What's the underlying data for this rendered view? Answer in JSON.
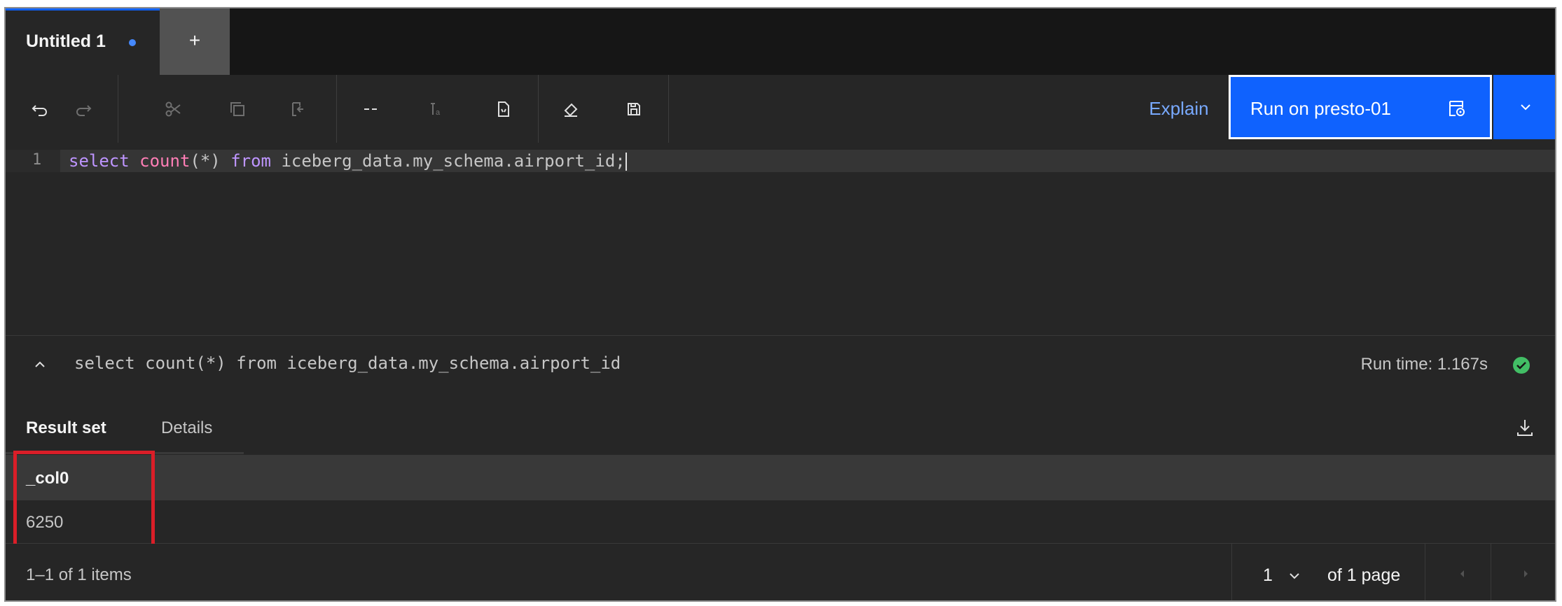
{
  "tabs": {
    "active_label": "Untitled 1",
    "add_label": "+"
  },
  "toolbar": {
    "icons": [
      "undo-icon",
      "redo-icon",
      "cut-icon",
      "copy-icon",
      "paste-icon",
      "comment-icon",
      "format-icon",
      "template-icon",
      "clear-icon",
      "save-icon"
    ],
    "explain_label": "Explain",
    "run_label": "Run on presto-01",
    "accent": "#0f62fe"
  },
  "editor": {
    "line_number": "1",
    "keyword_select": "select",
    "fn_count": "count",
    "args": "(*) ",
    "keyword_from": "from",
    "rest": " iceberg_data.my_schema.airport_id;"
  },
  "result": {
    "query": "select count(*) from iceberg_data.my_schema.airport_id",
    "run_time": "Run time: 1.167s",
    "status_color": "#42be65",
    "tabs": [
      "Result set",
      "Details"
    ],
    "columns": [
      "_col0"
    ],
    "rows": [
      [
        "6250"
      ]
    ],
    "highlight_color": "#da1e28"
  },
  "pagination": {
    "items": "1–1 of 1 items",
    "page": "1",
    "of_pages": "of 1 page"
  }
}
